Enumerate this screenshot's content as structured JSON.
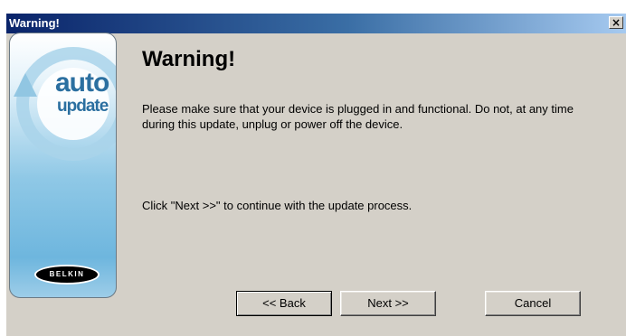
{
  "window": {
    "title": "Warning!",
    "close_glyph": "×"
  },
  "side_panel": {
    "logo_line1": "auto",
    "logo_line2": "update",
    "brand": "BELKIN",
    "icon": "circular-arrow-icon"
  },
  "content": {
    "heading": "Warning!",
    "message": "Please make sure that your device is plugged in and functional.  Do not, at any time during this update, unplug or power off the device.",
    "instruction": "Click \"Next >>\" to continue with the update process."
  },
  "buttons": {
    "back": "<< Back",
    "next": "Next >>",
    "cancel": "Cancel"
  },
  "colors": {
    "titlebar_start": "#0a246a",
    "titlebar_end": "#a6caf0",
    "dialog_bg": "#d4d0c8",
    "logo_blue": "#2b6fa0"
  }
}
